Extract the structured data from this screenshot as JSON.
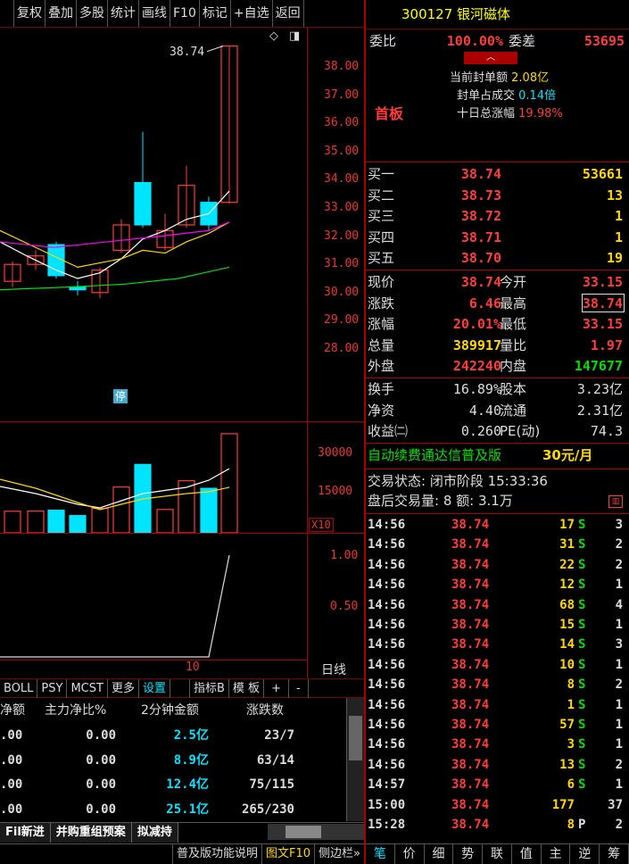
{
  "toolbar": {
    "items": [
      "复权",
      "叠加",
      "多股",
      "统计",
      "画线",
      "F10",
      "标记",
      "+自选",
      "返回"
    ]
  },
  "stock": {
    "code": "300127",
    "name": "银河磁体"
  },
  "chart": {
    "top_label": "38.74",
    "price_axis": [
      "38.00",
      "37.00",
      "36.00",
      "35.00",
      "34.00",
      "33.00",
      "32.00",
      "31.00",
      "30.00",
      "29.00",
      "28.00"
    ],
    "stop_badge": "停",
    "vol_axis": [
      "30000",
      "15000"
    ],
    "vol_unit": "X10",
    "ind_axis": [
      "1.00",
      "0.50"
    ],
    "date_label": "10",
    "period_label": "日线",
    "colors": {
      "up": "#ff3b3b",
      "down": "#00e5ff",
      "ma1": "#ffffff",
      "ma2": "#ffd800",
      "ma3": "#ff00ff",
      "ma4": "#00e000"
    }
  },
  "indicator_tabs": [
    "BOLL",
    "PSY",
    "MCST",
    "更多",
    "设置",
    "指标B",
    "模 板",
    "+",
    "-"
  ],
  "fund_table": {
    "headers": [
      "净额",
      "主力净比%",
      "2分钟金额",
      "涨跌数"
    ],
    "rows": [
      [
        ".00",
        "0.00",
        "2.5亿",
        "23/7"
      ],
      [
        ".00",
        "0.00",
        "8.9亿",
        "63/14"
      ],
      [
        ".00",
        "0.00",
        "12.4亿",
        "75/115"
      ],
      [
        ".00",
        "0.00",
        "25.1亿",
        "265/230"
      ]
    ]
  },
  "bottom_tabs": [
    "Fil新进",
    "并购重组预案",
    "拟减持"
  ],
  "status_items": [
    "普及版功能说明",
    "图文F10",
    "侧边栏»"
  ],
  "order": {
    "weibi_label": "委比",
    "weibi": "100.00%",
    "weicha_label": "委差",
    "weicha": "53695",
    "board": "首板",
    "seal_label": "当前封单额",
    "seal": "2.08亿",
    "seal_ratio_label": "封单占成交",
    "seal_ratio": "0.14倍",
    "ten_day_label": "十日总涨幅",
    "ten_day": "19.98%",
    "bids": [
      {
        "label": "买一",
        "price": "38.74",
        "vol": "53661"
      },
      {
        "label": "买二",
        "price": "38.73",
        "vol": "13"
      },
      {
        "label": "买三",
        "price": "38.72",
        "vol": "1"
      },
      {
        "label": "买四",
        "price": "38.71",
        "vol": "1"
      },
      {
        "label": "买五",
        "price": "38.70",
        "vol": "19"
      }
    ]
  },
  "quote": [
    {
      "l1": "现价",
      "v1": "38.74",
      "l2": "今开",
      "v2": "33.15",
      "c1": "red",
      "c2": "red"
    },
    {
      "l1": "涨跌",
      "v1": "6.46",
      "l2": "最高",
      "v2": "38.74",
      "c1": "red",
      "c2": "red"
    },
    {
      "l1": "涨幅",
      "v1": "20.01%",
      "l2": "最低",
      "v2": "33.15",
      "c1": "red",
      "c2": "red"
    },
    {
      "l1": "总量",
      "v1": "389917",
      "l2": "量比",
      "v2": "1.97",
      "c1": "yel",
      "c2": "red"
    },
    {
      "l1": "外盘",
      "v1": "242240",
      "l2": "内盘",
      "v2": "147677",
      "c1": "red",
      "c2": "grn"
    }
  ],
  "fin": [
    {
      "l1": "换手",
      "v1": "16.89%",
      "l2": "股本",
      "v2": "3.23亿"
    },
    {
      "l1": "净资",
      "v1": "4.40",
      "l2": "流通",
      "v2": "2.31亿"
    },
    {
      "l1": "收益㈡",
      "v1": "0.260",
      "l2": "PE(动)",
      "v2": "74.3"
    }
  ],
  "promo": {
    "text": "自动续费通达信普及版",
    "price": "30元/月"
  },
  "trade": {
    "status": "交易状态: 闭市阶段 15:33:36",
    "after": "盘后交易量: 8  额: 3.1万"
  },
  "ticks": [
    {
      "t": "14:56",
      "p": "38.74",
      "v": "17",
      "d": "S",
      "n": "3"
    },
    {
      "t": "14:56",
      "p": "38.74",
      "v": "31",
      "d": "S",
      "n": "2"
    },
    {
      "t": "14:56",
      "p": "38.74",
      "v": "22",
      "d": "S",
      "n": "2"
    },
    {
      "t": "14:56",
      "p": "38.74",
      "v": "12",
      "d": "S",
      "n": "1"
    },
    {
      "t": "14:56",
      "p": "38.74",
      "v": "68",
      "d": "S",
      "n": "4"
    },
    {
      "t": "14:56",
      "p": "38.74",
      "v": "15",
      "d": "S",
      "n": "1"
    },
    {
      "t": "14:56",
      "p": "38.74",
      "v": "14",
      "d": "S",
      "n": "3"
    },
    {
      "t": "14:56",
      "p": "38.74",
      "v": "10",
      "d": "S",
      "n": "1"
    },
    {
      "t": "14:56",
      "p": "38.74",
      "v": "8",
      "d": "S",
      "n": "2"
    },
    {
      "t": "14:56",
      "p": "38.74",
      "v": "1",
      "d": "S",
      "n": "1"
    },
    {
      "t": "14:56",
      "p": "38.74",
      "v": "57",
      "d": "S",
      "n": "1"
    },
    {
      "t": "14:56",
      "p": "38.74",
      "v": "3",
      "d": "S",
      "n": "1"
    },
    {
      "t": "14:56",
      "p": "38.74",
      "v": "13",
      "d": "S",
      "n": "2"
    },
    {
      "t": "14:57",
      "p": "38.74",
      "v": "6",
      "d": "S",
      "n": "1"
    },
    {
      "t": "15:00",
      "p": "38.74",
      "v": "177",
      "d": "",
      "n": "37"
    },
    {
      "t": "15:28",
      "p": "38.74",
      "v": "8",
      "d": "P",
      "n": "2"
    }
  ],
  "right_tabs": [
    "笔",
    "价",
    "细",
    "势",
    "联",
    "值",
    "主",
    "逆",
    "筹"
  ]
}
